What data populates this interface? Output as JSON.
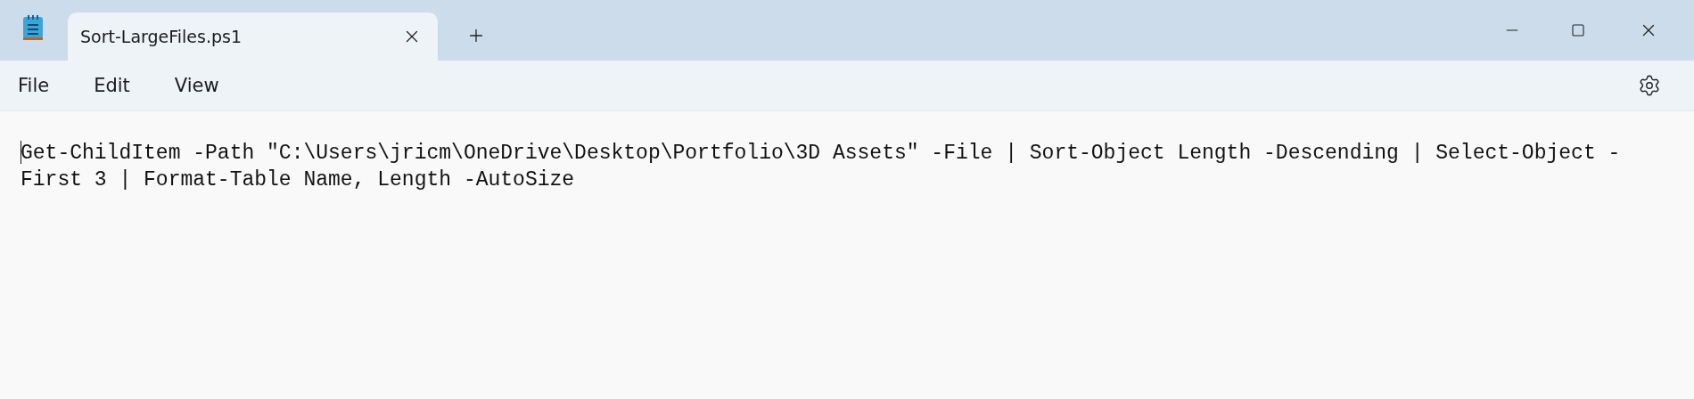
{
  "tabs": [
    {
      "label": "Sort-LargeFiles.ps1",
      "selected": true
    }
  ],
  "menu": [
    "File",
    "Edit",
    "View"
  ],
  "editor": {
    "text": "Get-ChildItem -Path \"C:\\Users\\jricm\\OneDrive\\Desktop\\Portfolio\\3D Assets\" -File | Sort-Object Length -Descending | Select-Object -First 3 | Format-Table Name, Length -AutoSize"
  }
}
